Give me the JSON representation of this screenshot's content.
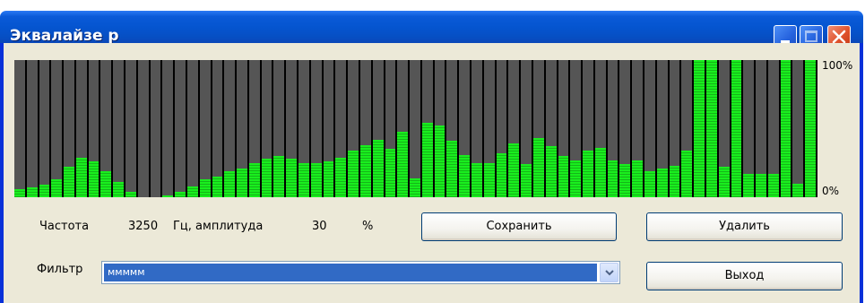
{
  "window": {
    "title": "Эквалайзе р",
    "controls": [
      "minimize-icon",
      "maximize-icon",
      "close-icon"
    ]
  },
  "equalizer": {
    "scale_max_label": "100%",
    "scale_min_label": "0%",
    "bar_color": "#19ee1e",
    "track_color": "#555555",
    "levels_percent": [
      6,
      7,
      9,
      13,
      22,
      29,
      26,
      19,
      11,
      4,
      0,
      0,
      1,
      4,
      8,
      13,
      15,
      19,
      21,
      25,
      28,
      30,
      28,
      25,
      25,
      26,
      29,
      34,
      38,
      42,
      35,
      48,
      14,
      54,
      52,
      41,
      31,
      25,
      25,
      32,
      39,
      24,
      43,
      37,
      30,
      27,
      34,
      36,
      27,
      24,
      27,
      19,
      21,
      23,
      34,
      100,
      100,
      22,
      100,
      17,
      17,
      17,
      100,
      10,
      100
    ]
  },
  "controls": {
    "frequency_label": "Частота",
    "frequency_value": "3250",
    "amplitude_label": "Гц, амплитуда",
    "amplitude_value": "30",
    "percent_sign": "%",
    "save_button": "Сохранить",
    "delete_button": "Удалить",
    "exit_button": "Выход",
    "filter_label": "Фильтр",
    "filter_selected": "ммммм"
  }
}
